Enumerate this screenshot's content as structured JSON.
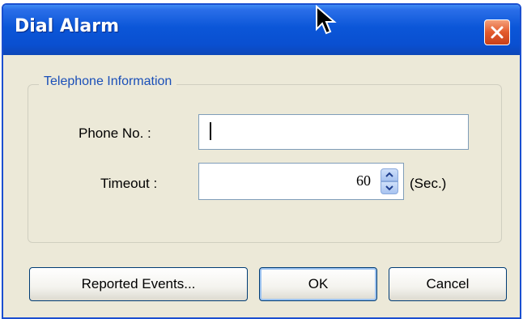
{
  "window": {
    "title": "Dial Alarm",
    "close_icon": "close-icon"
  },
  "group": {
    "label": "Telephone Information"
  },
  "phone": {
    "label": "Phone No. :",
    "value": ""
  },
  "timeout": {
    "label": "Timeout :",
    "value": "60",
    "unit": "(Sec.)",
    "up_icon": "chevron-up-icon",
    "down_icon": "chevron-down-icon"
  },
  "buttons": {
    "reported_events": "Reported Events...",
    "ok": "OK",
    "cancel": "Cancel"
  },
  "colors": {
    "titlebar": "#0a4fd0",
    "close": "#e35a2c",
    "dialog_bg": "#ece9d8",
    "group_label": "#1a4fb8"
  }
}
